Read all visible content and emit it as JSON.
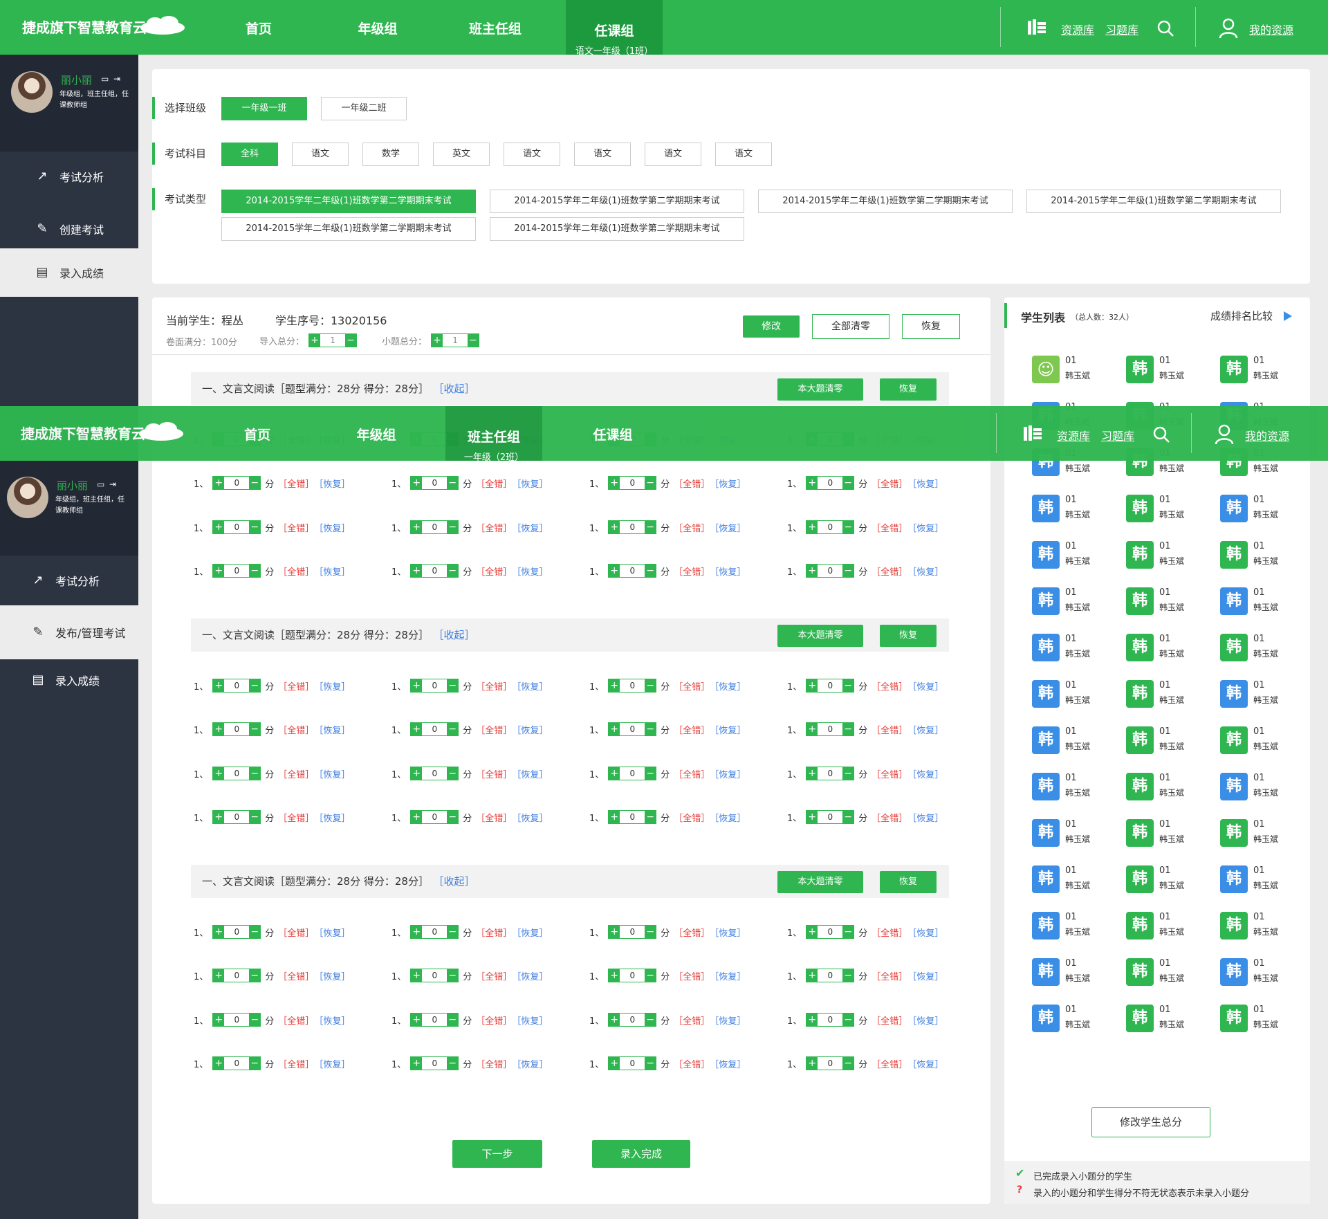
{
  "brand": "捷成旗下智慧教育云",
  "nav": {
    "home": "首页",
    "grade_group": "年级组",
    "class_teacher": "班主任组",
    "subject_teacher": "任课组",
    "subject_teacher_sub": "语文一年级（1班）",
    "overlay_active_sub": "一年级（2班）",
    "resources": "资源库",
    "exercises": "习题库",
    "my_resources": "我的资源"
  },
  "profile": {
    "name": "丽小丽",
    "roles": "年级组，班主任组，任课教师组"
  },
  "sidebar": {
    "exam_analysis": "考试分析",
    "create_exam": "创建考试",
    "enter_scores": "录入成绩",
    "publish_manage": "发布/管理考试"
  },
  "filters": {
    "class_label": "选择班级",
    "classes": [
      "一年级一班",
      "一年级二班"
    ],
    "subject_label": "考试科目",
    "subjects": [
      "全科",
      "语文",
      "数学",
      "英文",
      "语文",
      "语文",
      "语文",
      "语文"
    ],
    "type_label": "考试类型",
    "exam_types": [
      "2014-2015学年二年级(1)班数学第二学期期末考试",
      "2014-2015学年二年级(1)班数学第二学期期末考试",
      "2014-2015学年二年级(1)班数学第二学期期末考试",
      "2014-2015学年二年级(1)班数学第二学期期末考试",
      "2014-2015学年二年级(1)班数学第二学期期末考试",
      "2014-2015学年二年级(1)班数学第二学期期末考试"
    ]
  },
  "student": {
    "current_label": "当前学生：程丛",
    "id_label": "学生序号：13020156",
    "paper_full": "卷面满分：100分",
    "import_total": "导入总分：",
    "import_total_value": "1",
    "sub_total": "小题总分：",
    "sub_total_value": "1",
    "btn_edit": "修改",
    "btn_clear_all": "全部清零",
    "btn_restore": "恢复"
  },
  "sections": [
    {
      "title": "一、文言文阅读［题型满分：28分 得分：28分］",
      "collapse": "［收起］",
      "clear": "本大题清零",
      "restore": "恢复"
    },
    {
      "title": "一、文言文阅读［题型满分：28分 得分：28分］",
      "collapse": "［收起］",
      "clear": "本大题清零",
      "restore": "恢复"
    },
    {
      "title": "一、文言文阅读［题型满分：28分 得分：28分］",
      "collapse": "［收起］",
      "clear": "本大题清零",
      "restore": "恢复"
    }
  ],
  "question": {
    "index": "1、",
    "value": "0",
    "unit": "分",
    "wrong": "［全错］",
    "restore": "［恢复］"
  },
  "buttons": {
    "next": "下一步",
    "finish": "录入完成"
  },
  "student_list": {
    "title": "学生列表",
    "count": "（总人数：32人）",
    "compare": "成绩排名比较",
    "student_no": "01",
    "student_name": "韩玉斌",
    "badge_char": "韩",
    "edit_total": "修改学生总分",
    "legend_done": "已完成录入小题分的学生",
    "legend_warn": "录入的小题分和学生得分不符无状态表示未录入小题分"
  },
  "colors": {
    "green": "#2fb650",
    "blue": "#3a8ee6",
    "red": "#e53935"
  }
}
